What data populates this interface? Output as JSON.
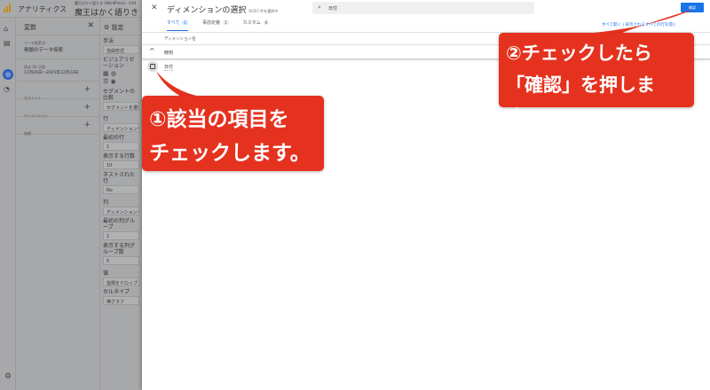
{
  "app": {
    "title": "アナリティクス",
    "property_small": "魔王はかく語りき (WordPress) - GA4",
    "property": "魔王はかく語りき（W"
  },
  "variables": {
    "title": "変数",
    "exploration_label": "データ探索名:",
    "exploration_name": "無題のデータ探索",
    "date_label": "過去 28 日間",
    "date_range": "11月26日～2025年12月23日",
    "segments": "セグメント",
    "dimensions": "ディメンション",
    "metrics": "指標"
  },
  "settings": {
    "title": "設定",
    "technique_label": "手法",
    "technique": "自由形式",
    "viz_label": "ビジュアリゼーション",
    "segment_compare": "セグメントの比較",
    "segment_add": "セグメントを選択",
    "rows": "行",
    "row_dim": "ディメンションをドロップするか選択",
    "first_row_label": "最初の行",
    "first_row": "1",
    "rows_shown_label": "表示する行数",
    "rows_shown": "10",
    "nested_label": "ネストされた行",
    "nested": "No",
    "cols": "列",
    "col_dim": "ディメンションをドロップするか選択",
    "first_col_label": "最初の列グループ",
    "first_col": "1",
    "cols_shown_label": "表示する列グループ数",
    "cols_shown": "5",
    "values": "値",
    "values_drop": "指標をドロップしてください",
    "cell_type_label": "セルタイプ",
    "cell_type": "棒グラフ"
  },
  "modal": {
    "title": "ディメンションの選択",
    "count": "0/357 件を選択中",
    "search_value": "日付",
    "confirm": "確認",
    "tabs": [
      {
        "label": "すべて",
        "count": "1"
      },
      {
        "label": "事前定義",
        "count": "1"
      },
      {
        "label": "カスタム",
        "count": "0"
      }
    ],
    "expand_all": "すべて開く",
    "expand_rows": "表示されるすべての行を開く",
    "column_header": "ディメンション名",
    "group": "時刻",
    "item": "日付"
  },
  "callouts": {
    "c1_line1": "①該当の項目を",
    "c1_line2": "チェックします。",
    "c2_line1": "②チェックしたら",
    "c2_line2": "「確認」を押します。",
    "color": "#e5321f"
  }
}
